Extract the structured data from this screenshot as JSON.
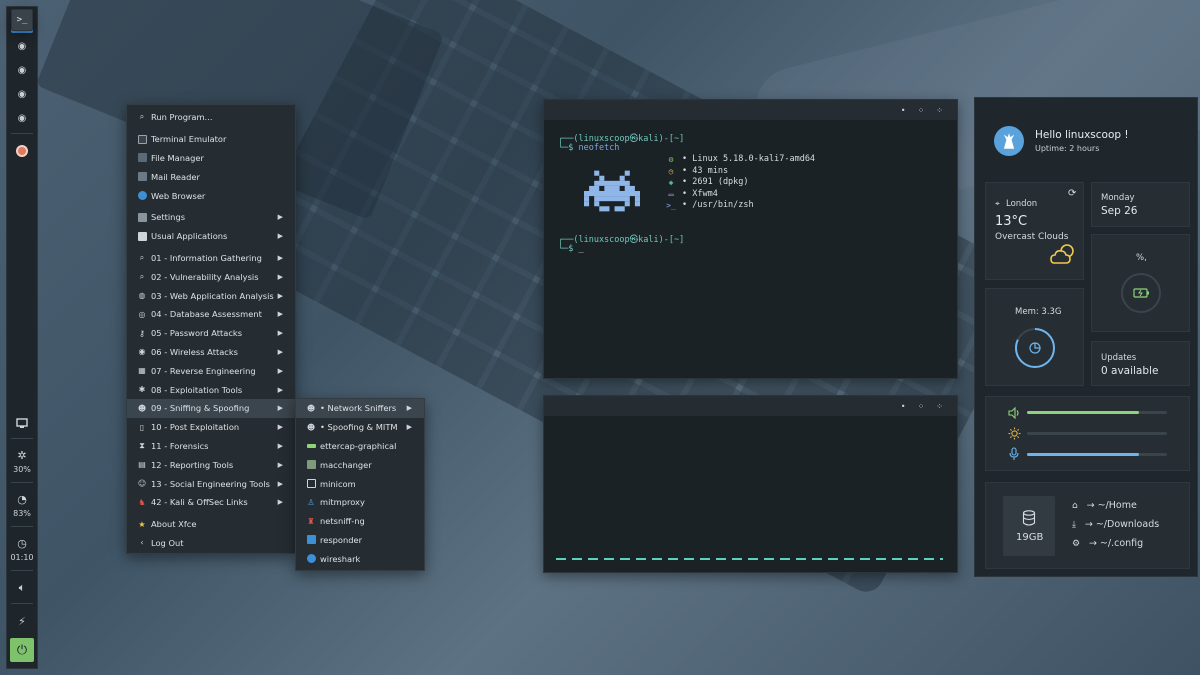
{
  "panel": {
    "stats": [
      {
        "icon": "cpu-icon",
        "value": "30%"
      },
      {
        "icon": "pie-icon",
        "value": "83%"
      },
      {
        "icon": "clock-icon",
        "value": "01:10"
      }
    ]
  },
  "menu": {
    "items": [
      {
        "label": "Run Program...",
        "icon": "search-icon"
      },
      {
        "label": "Terminal Emulator",
        "icon": "terminal-icon"
      },
      {
        "label": "File Manager",
        "icon": "folder-icon"
      },
      {
        "label": "Mail Reader",
        "icon": "mail-icon"
      },
      {
        "label": "Web Browser",
        "icon": "globe-icon"
      },
      {
        "label": "Settings",
        "icon": "settings-icon"
      },
      {
        "label": "Usual Applications",
        "icon": "apps-icon"
      },
      {
        "label": "01 - Information Gathering",
        "icon": "search-icon"
      },
      {
        "label": "02 - Vulnerability Analysis",
        "icon": "search-icon"
      },
      {
        "label": "03 - Web Application Analysis",
        "icon": "web-icon"
      },
      {
        "label": "04 - Database Assessment",
        "icon": "database-icon"
      },
      {
        "label": "05 - Password Attacks",
        "icon": "key-icon"
      },
      {
        "label": "06 - Wireless Attacks",
        "icon": "wifi-icon"
      },
      {
        "label": "07 - Reverse Engineering",
        "icon": "chip-icon"
      },
      {
        "label": "08 - Exploitation Tools",
        "icon": "bug-icon"
      },
      {
        "label": "09 - Sniffing & Spoofing",
        "icon": "spy-icon"
      },
      {
        "label": "10 - Post Exploitation",
        "icon": "door-icon"
      },
      {
        "label": "11 - Forensics",
        "icon": "hourglass-icon"
      },
      {
        "label": "12 - Reporting Tools",
        "icon": "report-icon"
      },
      {
        "label": "13 - Social Engineering Tools",
        "icon": "people-icon"
      },
      {
        "label": "42 - Kali & OffSec Links",
        "icon": "flame-icon"
      },
      {
        "label": "About Xfce",
        "icon": "star-icon"
      },
      {
        "label": "Log Out",
        "icon": "logout-icon"
      }
    ],
    "submenu": [
      {
        "label": "• Network Sniffers"
      },
      {
        "label": "• Spoofing & MITM"
      },
      {
        "label": "ettercap-graphical"
      },
      {
        "label": "macchanger"
      },
      {
        "label": "minicom"
      },
      {
        "label": "mitmproxy"
      },
      {
        "label": "netsniff-ng"
      },
      {
        "label": "responder"
      },
      {
        "label": "wireshark"
      }
    ]
  },
  "terminal1": {
    "prompt1_top": "┌──(linuxscoop㉿kali)-[~]",
    "prompt1_cmd_prefix": "└─$ ",
    "prompt1_cmd": "neofetch",
    "info": [
      {
        "icon": "gear-icon",
        "text": "• Linux 5.18.0-kali7-amd64",
        "color": "#7ec26b"
      },
      {
        "icon": "clock-icon",
        "text": "• 43 mins",
        "color": "#e0b24a"
      },
      {
        "icon": "package-icon",
        "text": "• 2691 (dpkg)",
        "color": "#6fc7bd"
      },
      {
        "icon": "window-icon",
        "text": "• Xfwm4",
        "color": "#c792ea"
      },
      {
        "icon": "shell-icon",
        "text": "• /usr/bin/zsh",
        "color": "#7ba7d9"
      }
    ],
    "prompt2_top": "┌──(linuxscoop㉿kali)-[~]",
    "prompt2_cmd_prefix": "└─$ ",
    "cursor": "_"
  },
  "sidebar": {
    "greeting": "Hello linuxscoop !",
    "uptime": "Uptime: 2 hours",
    "weather": {
      "location": "London",
      "temp": "13°C",
      "desc": "Overcast Clouds"
    },
    "date": {
      "day": "Monday",
      "date": "Sep 26"
    },
    "battery_label": "%,",
    "mem": "Mem: 3.3G",
    "updates": {
      "title": "Updates",
      "value": "0 available"
    },
    "sliders": [
      {
        "icon": "volume-icon",
        "level": 0.8,
        "color": "#8fd37a"
      },
      {
        "icon": "brightness-icon",
        "level": 0.0,
        "color": "#e0b24a"
      },
      {
        "icon": "mic-icon",
        "level": 0.8,
        "color": "#6eb4ee"
      }
    ],
    "disk": "19GB",
    "folders": [
      {
        "icon": "home-icon",
        "label": "→  ~/Home"
      },
      {
        "icon": "download-icon",
        "label": "→  ~/Downloads"
      },
      {
        "icon": "gear-icon",
        "label": "→  ~/.config"
      }
    ]
  }
}
